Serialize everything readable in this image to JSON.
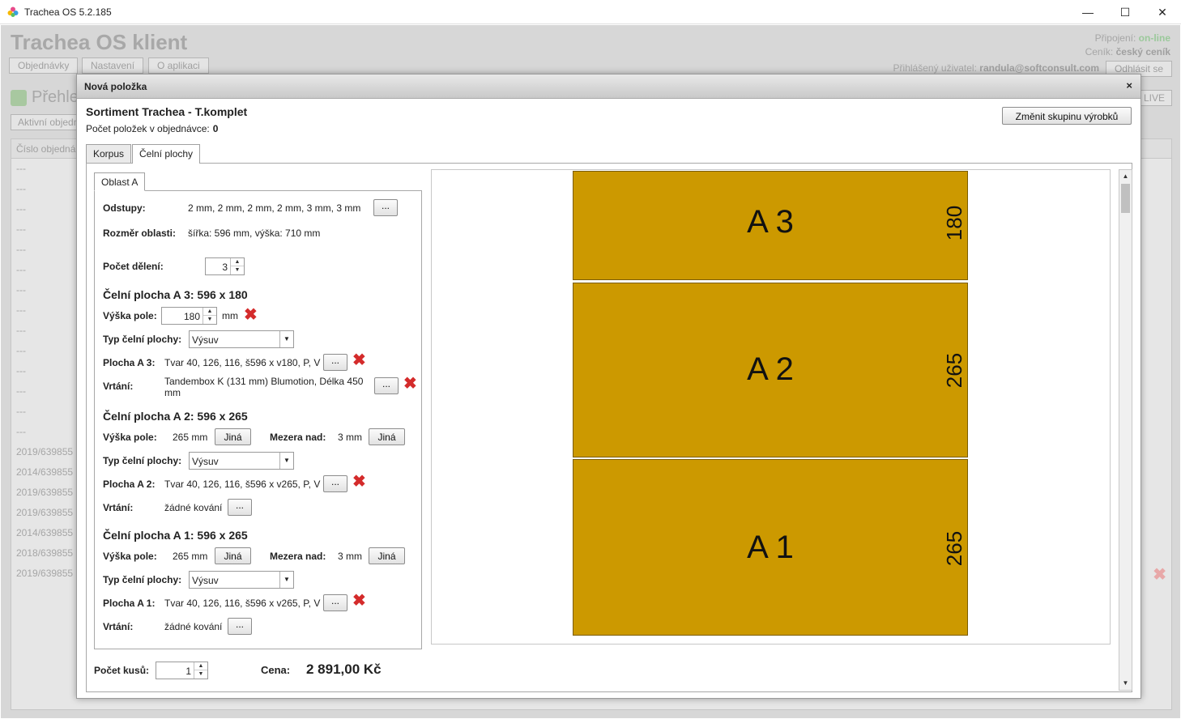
{
  "window": {
    "title": "Trachea OS 5.2.185",
    "minimize": "—",
    "maximize": "☐",
    "close": "✕"
  },
  "background": {
    "app_title": "Trachea OS klient",
    "nav": [
      "Objednávky",
      "Nastavení",
      "O aplikaci"
    ],
    "connection_label": "Připojení:",
    "connection_value": "on-line",
    "pricelist_label": "Ceník:",
    "pricelist_value": "český ceník",
    "user_label": "Přihlášený uživatel:",
    "user_value": "randula@softconsult.com",
    "logout": "Odhlásit se",
    "section_title": "Přehle",
    "active_button": "Aktivní objedn",
    "live_button": "LIVE",
    "grid_header": "Číslo objedná",
    "rows": [
      "---",
      "---",
      "---",
      "---",
      "---",
      "---",
      "---",
      "---",
      "---",
      "---",
      "---",
      "---",
      "---",
      "---",
      "2019/639855",
      "2014/639855",
      "2019/639855",
      "2019/639855",
      "2014/639855",
      "2018/639855",
      "2019/639855"
    ]
  },
  "dialog": {
    "title": "Nová položka",
    "close": "×",
    "sortiment": "Sortiment Trachea - T.komplet",
    "count_label": "Počet položek v objednávce:",
    "count_value": "0",
    "change_group": "Změnit skupinu výrobků",
    "tabs": [
      "Korpus",
      "Čelní plochy"
    ],
    "subtab": "Oblast A",
    "odstupy_label": "Odstupy:",
    "odstupy_value": "2 mm, 2 mm, 2 mm, 2 mm, 3 mm, 3 mm",
    "rozmer_label": "Rozměr oblasti:",
    "rozmer_value": "šířka: 596 mm, výška: 710 mm",
    "deleni_label": "Počet dělení:",
    "deleni_value": "3",
    "dots": "...",
    "sections": [
      {
        "heading": "Čelní plocha A 3: 596 x 180",
        "vyska_label": "Výška pole:",
        "vyska_value": "180",
        "vyska_unit": "mm",
        "typ_label": "Typ čelní plochy:",
        "typ_value": "Výsuv",
        "plocha_label": "Plocha A 3:",
        "plocha_value": "Tvar 40, 126, 116, š596 x v180, P, V",
        "vrtani_label": "Vrtání:",
        "vrtani_value": "Tandembox K (131 mm) Blumotion, Délka 450 mm"
      },
      {
        "heading": "Čelní plocha A 2: 596 x 265",
        "vyska_label": "Výška pole:",
        "vyska_value": "265 mm",
        "jina": "Jiná",
        "mezera_label": "Mezera nad:",
        "mezera_value": "3 mm",
        "typ_label": "Typ čelní plochy:",
        "typ_value": "Výsuv",
        "plocha_label": "Plocha A 2:",
        "plocha_value": "Tvar 40, 126, 116, š596 x v265, P, V",
        "vrtani_label": "Vrtání:",
        "vrtani_value": "žádné kování"
      },
      {
        "heading": "Čelní plocha A 1: 596 x 265",
        "vyska_label": "Výška pole:",
        "vyska_value": "265 mm",
        "jina": "Jiná",
        "mezera_label": "Mezera nad:",
        "mezera_value": "3 mm",
        "typ_label": "Typ čelní plochy:",
        "typ_value": "Výsuv",
        "plocha_label": "Plocha A 1:",
        "plocha_value": "Tvar 40, 126, 116, š596 x v265, P, V",
        "vrtani_label": "Vrtání:",
        "vrtani_value": "žádné kování"
      }
    ],
    "pieces_label": "Počet kusů:",
    "pieces_value": "1",
    "price_label": "Cena:",
    "price_value": "2 891,00 Kč",
    "preview": [
      {
        "name": "A 3",
        "height": "180"
      },
      {
        "name": "A 2",
        "height": "265"
      },
      {
        "name": "A 1",
        "height": "265"
      }
    ],
    "front_color": "#cc9900"
  }
}
